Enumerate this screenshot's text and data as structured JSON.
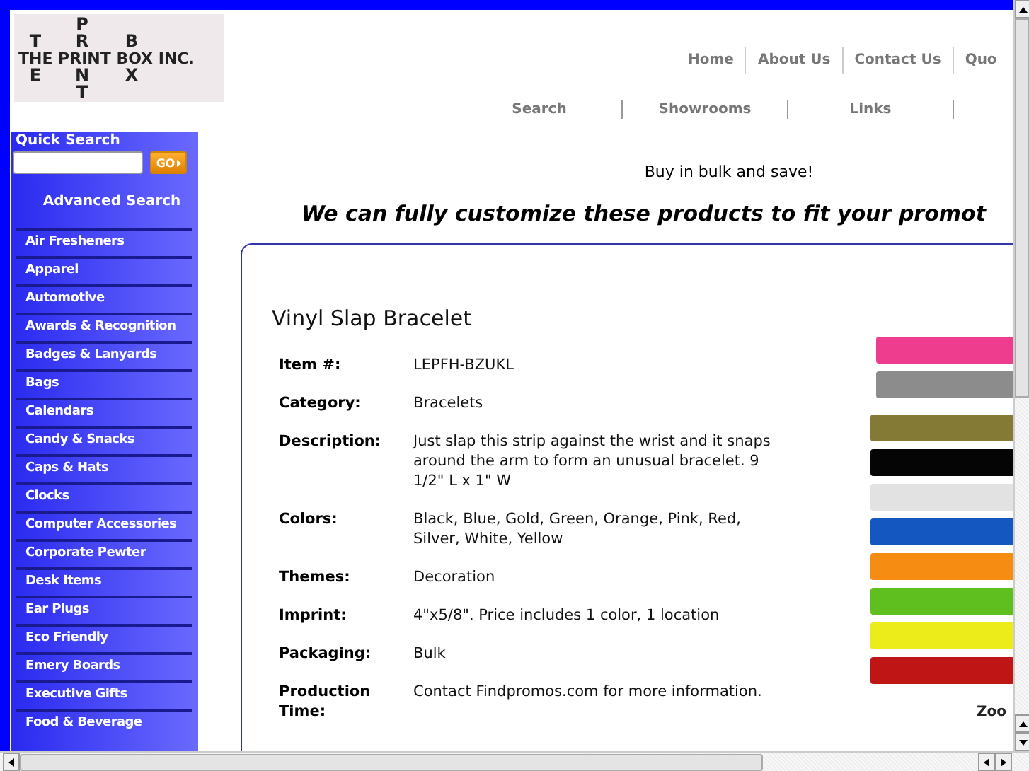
{
  "logo": {
    "across": "THE PRINT BOX INC.",
    "down": [
      {
        "above": "T",
        "below": "E"
      },
      {
        "above": "PR",
        "below": "NT"
      },
      {
        "above": "B",
        "below": "X"
      }
    ]
  },
  "top_nav": [
    "Home",
    "About Us",
    "Contact Us",
    "Quo"
  ],
  "sub_nav": [
    "Search",
    "Showrooms",
    "Links"
  ],
  "sidebar": {
    "quick_search_label": "Quick Search",
    "go_button": "GO",
    "advanced_search": "Advanced Search",
    "categories": [
      "Air Fresheners",
      "Apparel",
      "Automotive",
      "Awards & Recognition",
      "Badges & Lanyards",
      "Bags",
      "Calendars",
      "Candy & Snacks",
      "Caps & Hats",
      "Clocks",
      "Computer Accessories",
      "Corporate Pewter",
      "Desk Items",
      "Ear Plugs",
      "Eco Friendly",
      "Emery Boards",
      "Executive Gifts",
      "Food & Beverage"
    ]
  },
  "tagline": "Buy in bulk and save!",
  "headline": "We can fully customize these products to fit your promot",
  "product": {
    "title": "Vinyl Slap Bracelet",
    "details": [
      {
        "label": "Item #:",
        "value": "LEPFH-BZUKL"
      },
      {
        "label": "Category:",
        "value": "Bracelets"
      },
      {
        "label": "Description:",
        "value": "Just slap this strip against the wrist and it snaps around the arm to form an unusual bracelet. 9 1/2\" L x 1\" W"
      },
      {
        "label": "Colors:",
        "value": "Black, Blue, Gold, Green, Orange, Pink, Red, Silver, White, Yellow"
      },
      {
        "label": "Themes:",
        "value": "Decoration"
      },
      {
        "label": "Imprint:",
        "value": "4\"x5/8\". Price includes 1 color, 1 location"
      },
      {
        "label": "Packaging:",
        "value": "Bulk"
      },
      {
        "label": "Production Time:",
        "value": "Contact Findpromos.com for more information."
      }
    ],
    "zoom_label": "Zoo"
  }
}
